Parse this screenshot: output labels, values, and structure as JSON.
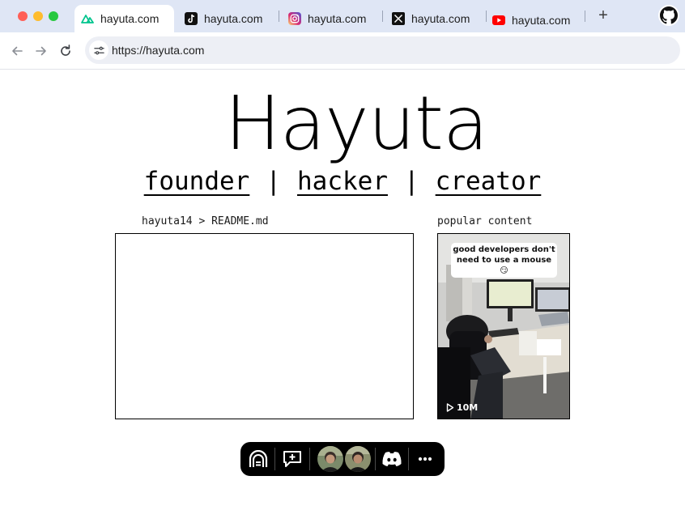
{
  "browser": {
    "tabs": [
      {
        "label": "hayuta.com",
        "icon": "nuxt-icon",
        "active": true
      },
      {
        "label": "hayuta.com",
        "icon": "tiktok-icon",
        "active": false
      },
      {
        "label": "hayuta.com",
        "icon": "instagram-icon",
        "active": false
      },
      {
        "label": "hayuta.com",
        "icon": "x-icon",
        "active": false
      },
      {
        "label": "hayuta.com",
        "icon": "youtube-icon",
        "active": false
      }
    ],
    "new_tab_label": "+",
    "url": "https://hayuta.com"
  },
  "page": {
    "title": "Hayuta",
    "roles": [
      "founder",
      "hacker",
      "creator"
    ],
    "separator": "|",
    "readme_label": "hayuta14 > README.md",
    "popular_label": "popular content",
    "popular": {
      "caption": "good developers don't need to use a mouse 😏",
      "views": "10M"
    }
  },
  "dock": {
    "items": [
      "logo-icon",
      "comment-icon",
      "avatar",
      "avatar",
      "discord-icon",
      "more-icon"
    ]
  },
  "colors": {
    "tabbar_bg": "#dfe6f5",
    "omnibox_bg": "#edeff5",
    "dock_bg": "#000000",
    "traffic_red": "#ff5f57",
    "traffic_yellow": "#febc2e",
    "traffic_green": "#28c840"
  }
}
